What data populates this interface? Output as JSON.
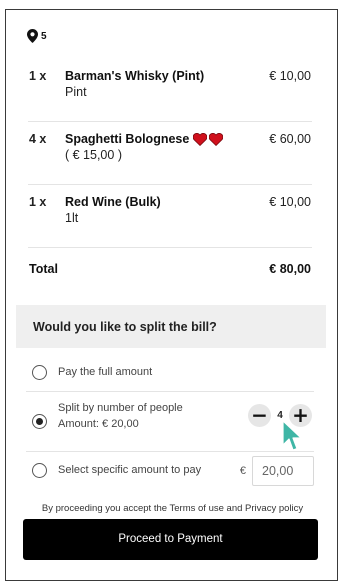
{
  "table": {
    "number": "5",
    "icon": "location-pin-icon"
  },
  "order_items": [
    {
      "qty": "1 x",
      "name": "Barman's Whisky (Pint)",
      "sub": "Pint",
      "price": "€ 10,00",
      "hearts": 0
    },
    {
      "qty": "4 x",
      "name": "Spaghetti Bolognese",
      "sub": "( € 15,00 )",
      "price": "€ 60,00",
      "hearts": 2
    },
    {
      "qty": "1 x",
      "name": "Red Wine (Bulk)",
      "sub": "1lt",
      "price": "€ 10,00",
      "hearts": 0
    }
  ],
  "total": {
    "label": "Total",
    "value": "€ 80,00"
  },
  "split": {
    "question": "Would you like to split the bill?",
    "options": {
      "full": {
        "label": "Pay the full amount",
        "selected": false
      },
      "by_people": {
        "label": "Split by number of people",
        "amount": "Amount: € 20,00",
        "selected": true,
        "count": "4",
        "minus": "−",
        "plus": "+"
      },
      "specific": {
        "label": "Select specific amount to pay",
        "selected": false,
        "currency": "€",
        "value": "20,00"
      }
    }
  },
  "terms": {
    "prefix": "By proceeding you accept the",
    "terms_link": "Terms of use",
    "and": "and",
    "privacy_link": "Privacy policy"
  },
  "pay_button": {
    "label": "Proceed to Payment"
  },
  "colors": {
    "heart": "#d0101c",
    "cursor": "#3fb6a6",
    "button_bg": "#000000"
  }
}
